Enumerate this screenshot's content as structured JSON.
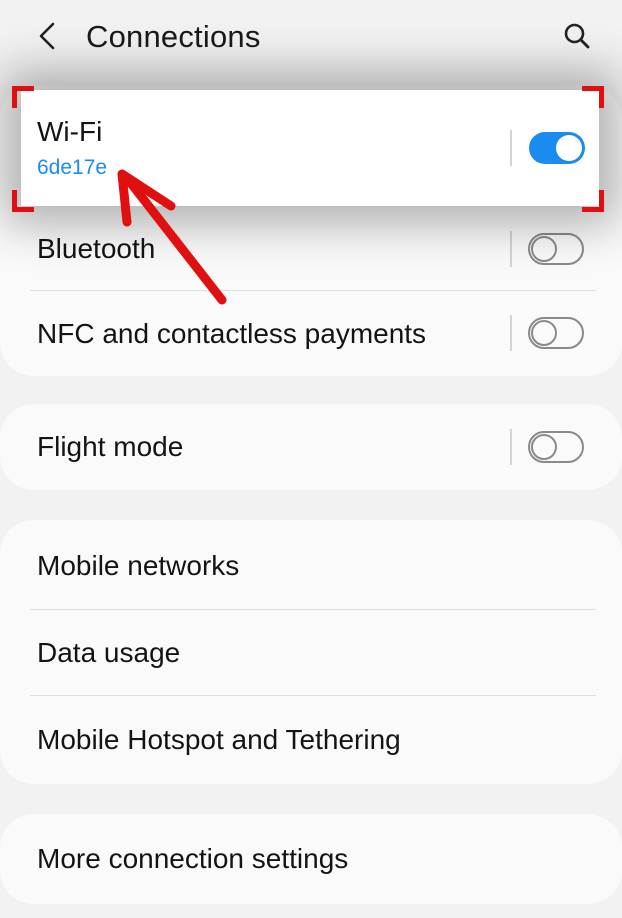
{
  "header": {
    "title": "Connections",
    "back_icon": "chevron-left-icon",
    "search_icon": "search-icon"
  },
  "wifi": {
    "label": "Wi-Fi",
    "network": "6de17e",
    "enabled": true
  },
  "group1": {
    "items": [
      {
        "label": "Bluetooth",
        "enabled": false
      },
      {
        "label": "NFC and contactless payments",
        "enabled": false
      }
    ]
  },
  "group2": {
    "items": [
      {
        "label": "Flight mode",
        "enabled": false
      }
    ]
  },
  "group3": {
    "items": [
      {
        "label": "Mobile networks"
      },
      {
        "label": "Data usage"
      },
      {
        "label": "Mobile Hotspot and Tethering"
      }
    ]
  },
  "group4": {
    "items": [
      {
        "label": "More connection settings"
      }
    ]
  },
  "colors": {
    "accent": "#1a8cf0",
    "highlight": "#e01010",
    "background": "#f2f2f2",
    "card": "#fafafa"
  }
}
